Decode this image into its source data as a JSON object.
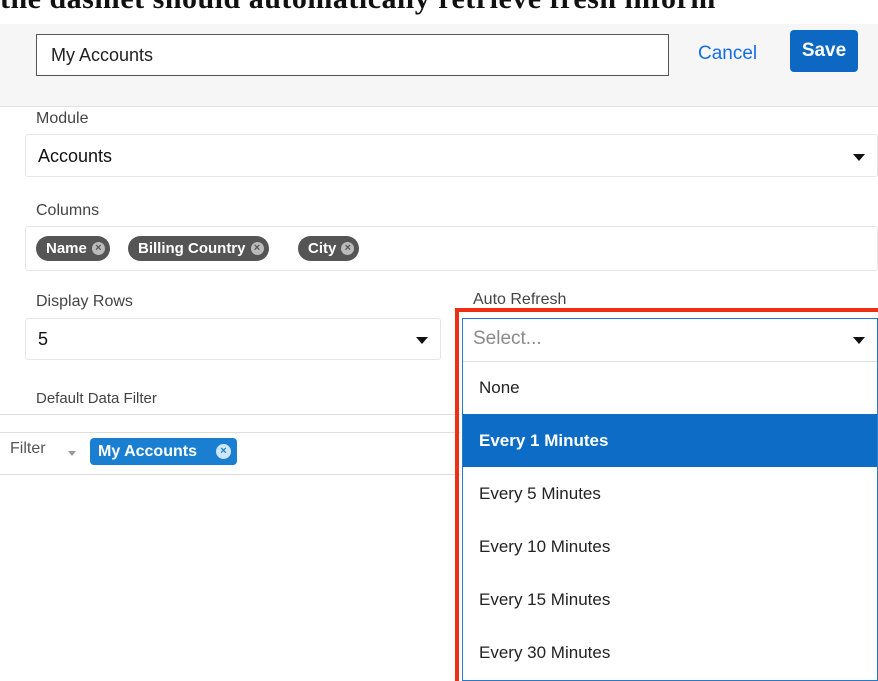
{
  "caption": "the dashlet should automatically retrieve fresh inform",
  "header": {
    "title_value": "My Accounts",
    "cancel_label": "Cancel",
    "save_label": "Save"
  },
  "module": {
    "label": "Module",
    "value": "Accounts"
  },
  "columns": {
    "label": "Columns",
    "items": [
      "Name",
      "Billing Country",
      "City"
    ]
  },
  "display_rows": {
    "label": "Display Rows",
    "value": "5"
  },
  "auto_refresh": {
    "label": "Auto Refresh",
    "placeholder": "Select...",
    "options": [
      "None",
      "Every 1 Minutes",
      "Every 5 Minutes",
      "Every 10 Minutes",
      "Every 15 Minutes",
      "Every 30 Minutes"
    ],
    "highlighted": "Every 1 Minutes"
  },
  "default_filter": {
    "label": "Default Data Filter",
    "filter_label": "Filter",
    "active_filter": "My Accounts"
  },
  "colors": {
    "accent": "#0c68c3",
    "highlight_border": "#ee2f16",
    "pill_bg": "#555555"
  },
  "icons": {
    "select_caret": "caret-down-icon",
    "pill_remove": "circle-x-icon"
  }
}
